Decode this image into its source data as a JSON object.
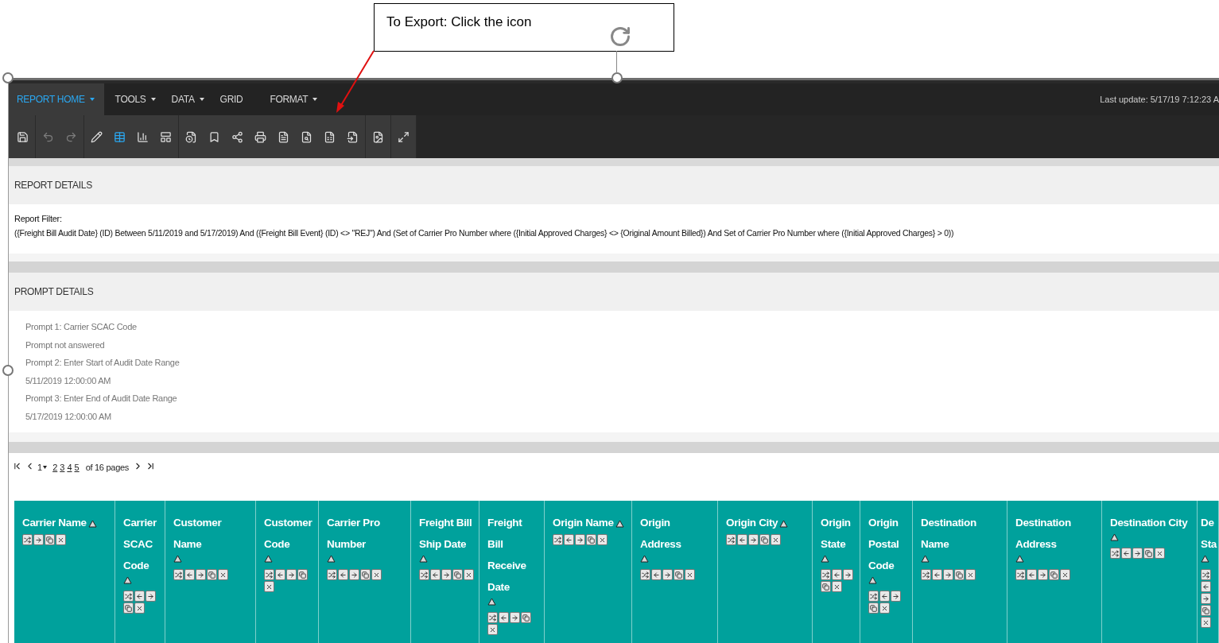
{
  "callout": {
    "text": "To Export: Click the icon"
  },
  "menu": {
    "items": [
      {
        "label": "REPORT HOME",
        "has_dropdown": true,
        "selected": true
      },
      {
        "label": "TOOLS",
        "has_dropdown": true,
        "selected": false
      },
      {
        "label": "DATA",
        "has_dropdown": true,
        "selected": false
      },
      {
        "label": "GRID",
        "has_dropdown": false,
        "selected": false
      },
      {
        "label": "FORMAT",
        "has_dropdown": true,
        "selected": false
      }
    ],
    "last_update": "Last update: 5/17/19 7:12:23 A"
  },
  "toolbar": {
    "groups": [
      [
        {
          "kind": "save",
          "selected": false,
          "disabled": false
        }
      ],
      [
        {
          "kind": "undo",
          "selected": false,
          "disabled": true
        },
        {
          "kind": "redo",
          "selected": false,
          "disabled": true
        }
      ],
      [
        {
          "kind": "design",
          "selected": false,
          "disabled": false
        },
        {
          "kind": "grid",
          "selected": true,
          "disabled": false
        },
        {
          "kind": "graph",
          "selected": false,
          "disabled": false
        },
        {
          "kind": "grid-graph",
          "selected": false,
          "disabled": false
        }
      ],
      [
        {
          "kind": "schedule",
          "selected": false,
          "disabled": false
        },
        {
          "kind": "bookmark",
          "selected": false,
          "disabled": false
        },
        {
          "kind": "share",
          "selected": false,
          "disabled": false
        },
        {
          "kind": "print",
          "selected": false,
          "disabled": false
        },
        {
          "kind": "file-check",
          "selected": false,
          "disabled": false
        },
        {
          "kind": "file-search",
          "selected": false,
          "disabled": false
        },
        {
          "kind": "export",
          "selected": false,
          "disabled": false
        },
        {
          "kind": "file-input",
          "selected": false,
          "disabled": false
        }
      ],
      [
        {
          "kind": "file-image",
          "selected": false,
          "disabled": false
        }
      ],
      [
        {
          "kind": "expand",
          "selected": false,
          "disabled": false
        }
      ]
    ]
  },
  "report_details": {
    "title": "REPORT DETAILS",
    "filter_label": "Report Filter:",
    "filter": "({Freight Bill Audit Date} (ID) Between 5/11/2019 and 5/17/2019) And ({Freight Bill Event} (ID) <> \"REJ\") And (Set of  Carrier Pro Number where ({Initial Approved Charges} <> {Original Amount Billed}) And Set of  Carrier Pro Number where ({Initial Approved Charges} > 0))"
  },
  "prompt_details": {
    "title": "PROMPT DETAILS",
    "lines": [
      "Prompt 1: Carrier SCAC Code",
      "Prompt not answered",
      "Prompt 2: Enter Start of Audit Date Range",
      "5/11/2019 12:00:00 AM",
      "Prompt 3: Enter End of Audit Date Range",
      "5/17/2019 12:00:00 AM"
    ]
  },
  "pager": {
    "current": "1",
    "pages": [
      "2",
      "3",
      "4",
      "5"
    ],
    "total": "of 16 pages"
  },
  "table": {
    "columns": [
      {
        "label": "Carrier Name",
        "move_left": false
      },
      {
        "label": "Carrier SCAC Code",
        "move_left": true
      },
      {
        "label": "Customer Name",
        "move_left": true
      },
      {
        "label": "Customer Code",
        "move_left": true
      },
      {
        "label": "Carrier Pro Number",
        "move_left": true
      },
      {
        "label": "Freight Bill Ship Date",
        "move_left": true
      },
      {
        "label": "Freight Bill Receive Date",
        "move_left": true
      },
      {
        "label": "Origin Name",
        "move_left": true
      },
      {
        "label": "Origin Address",
        "move_left": true
      },
      {
        "label": "Origin City",
        "move_left": true
      },
      {
        "label": "Origin State",
        "move_left": true
      },
      {
        "label": "Origin Postal Code",
        "move_left": true
      },
      {
        "label": "Destination Name",
        "move_left": true
      },
      {
        "label": "Destination Address",
        "move_left": true
      },
      {
        "label": "Destination City",
        "move_left": true
      },
      {
        "label": "De Sta",
        "move_left": true
      }
    ]
  }
}
